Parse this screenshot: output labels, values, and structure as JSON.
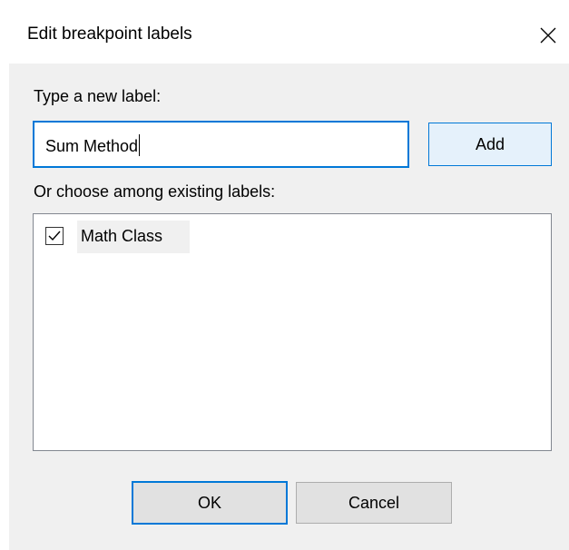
{
  "dialog": {
    "title": "Edit breakpoint labels",
    "close_icon": "close-icon"
  },
  "new_label": {
    "prompt": "Type a new label:",
    "value": "Sum Method",
    "add_button": "Add"
  },
  "existing": {
    "prompt": "Or choose among existing labels:",
    "items": [
      {
        "label": "Math Class",
        "checked": true
      }
    ]
  },
  "buttons": {
    "ok": "OK",
    "cancel": "Cancel"
  },
  "colors": {
    "accent": "#0078d7",
    "dialog_bg": "#f0f0f0",
    "button_bg": "#e1e1e1"
  }
}
